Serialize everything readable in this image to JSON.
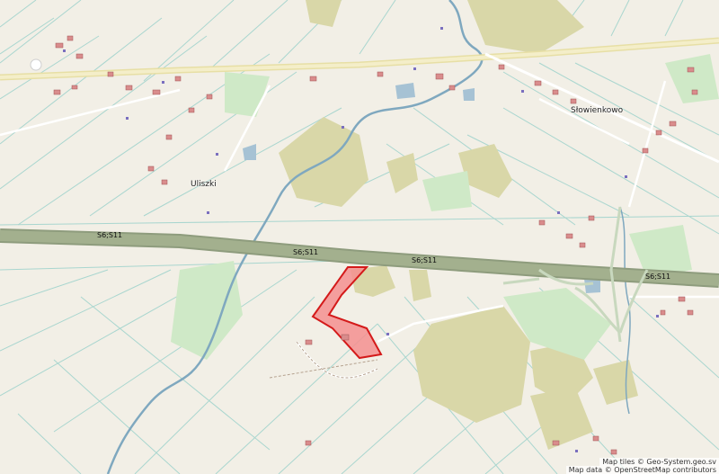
{
  "map": {
    "places": {
      "slowienkowo": "Słowienkowo",
      "uliszki": "Uliszki"
    },
    "road_ref": "S6;S11",
    "attribution": {
      "tiles": "Map tiles © Geo-System.geo.sv",
      "data": "Map data © OpenStreetMap contributors"
    },
    "colors": {
      "background": "#f2efe6",
      "motorway": "#a3b08e",
      "field_lines": "#a9d6cf",
      "river": "#7fa8bf",
      "woods": "#d9d7a8",
      "meadow": "#cfe9c7",
      "building": "#d98c8c",
      "parcel_fill": "#f58f8f",
      "parcel_stroke": "#d41a1a"
    }
  }
}
